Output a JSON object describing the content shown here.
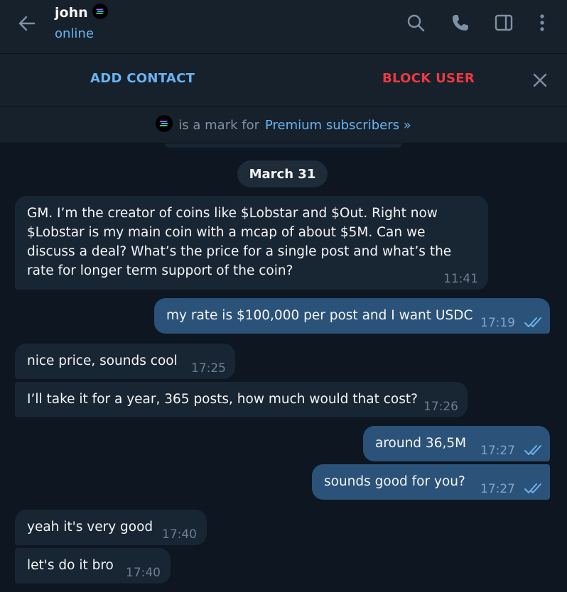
{
  "header": {
    "name": "john",
    "status": "online",
    "icons": [
      "back-arrow-icon",
      "premium-badge-icon",
      "search-icon",
      "phone-icon",
      "sidebar-toggle-icon",
      "more-vertical-icon"
    ]
  },
  "action_bar": {
    "add_contact": "ADD CONTACT",
    "block_user": "BLOCK USER"
  },
  "premium_notice": {
    "text": "is a mark for",
    "link": "Premium subscribers »"
  },
  "date_separator": "March 31",
  "messages": [
    {
      "direction": "in",
      "text": "GM. I’m the creator of coins like $Lobstar and $Out. Right now $Lobstar is my main coin with a mcap of about $5M. Can we discuss a deal? What’s the price for a single post and what’s the rate for longer term support of the coin?",
      "time": "11:41"
    },
    {
      "direction": "out",
      "text": "my rate is $100,000 per post and I want USDC",
      "time": "17:19",
      "read": true
    },
    {
      "direction": "in",
      "text": "nice price, sounds cool",
      "time": "17:25"
    },
    {
      "direction": "in",
      "text": "I’ll take it for a year, 365 posts, how much would that cost?",
      "time": "17:26"
    },
    {
      "direction": "out",
      "text": "around 36,5M",
      "time": "17:27",
      "read": true
    },
    {
      "direction": "out",
      "text": "sounds good for you?",
      "time": "17:27",
      "read": true
    },
    {
      "direction": "in",
      "text": "yeah it's very good",
      "time": "17:40"
    },
    {
      "direction": "in",
      "text": "let's do it bro",
      "time": "17:40"
    }
  ],
  "colors": {
    "background": "#0e1621",
    "header": "#17212b",
    "incoming_bubble": "#182533",
    "outgoing_bubble": "#2b5278",
    "accent_blue": "#6ab3f3",
    "danger_red": "#ec3942"
  }
}
